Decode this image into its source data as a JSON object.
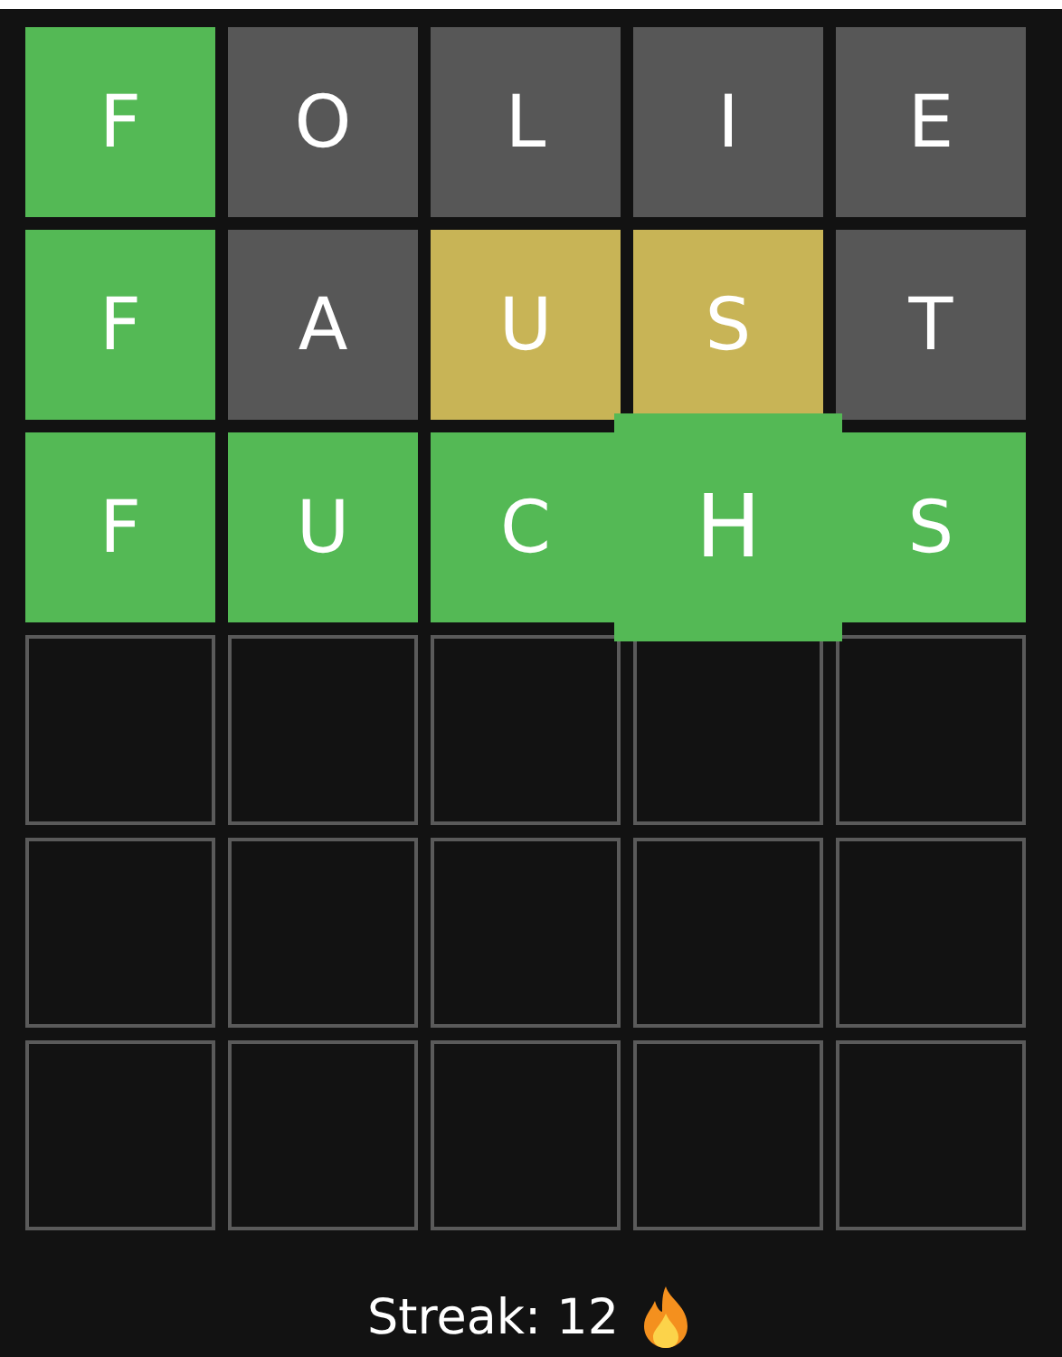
{
  "board": {
    "rows": [
      {
        "tiles": [
          {
            "letter": "F",
            "kind": "correct",
            "enlarged": false
          },
          {
            "letter": "O",
            "kind": "absent",
            "enlarged": false
          },
          {
            "letter": "L",
            "kind": "absent",
            "enlarged": false
          },
          {
            "letter": "I",
            "kind": "absent",
            "enlarged": false
          },
          {
            "letter": "E",
            "kind": "absent",
            "enlarged": false
          }
        ]
      },
      {
        "tiles": [
          {
            "letter": "F",
            "kind": "correct",
            "enlarged": false
          },
          {
            "letter": "A",
            "kind": "absent",
            "enlarged": false
          },
          {
            "letter": "U",
            "kind": "present",
            "enlarged": false
          },
          {
            "letter": "S",
            "kind": "present",
            "enlarged": false
          },
          {
            "letter": "T",
            "kind": "absent",
            "enlarged": false
          }
        ]
      },
      {
        "tiles": [
          {
            "letter": "F",
            "kind": "correct",
            "enlarged": false
          },
          {
            "letter": "U",
            "kind": "correct",
            "enlarged": false
          },
          {
            "letter": "C",
            "kind": "correct",
            "enlarged": false
          },
          {
            "letter": "H",
            "kind": "correct",
            "enlarged": true
          },
          {
            "letter": "S",
            "kind": "correct",
            "enlarged": false
          }
        ]
      },
      {
        "tiles": [
          {
            "kind": "empty"
          },
          {
            "kind": "empty"
          },
          {
            "kind": "empty"
          },
          {
            "kind": "empty"
          },
          {
            "kind": "empty"
          }
        ]
      },
      {
        "tiles": [
          {
            "kind": "empty"
          },
          {
            "kind": "empty"
          },
          {
            "kind": "empty"
          },
          {
            "kind": "empty"
          },
          {
            "kind": "empty"
          }
        ]
      },
      {
        "tiles": [
          {
            "kind": "empty"
          },
          {
            "kind": "empty"
          },
          {
            "kind": "empty"
          },
          {
            "kind": "empty"
          },
          {
            "kind": "empty"
          }
        ]
      }
    ]
  },
  "streak": {
    "label": "Streak: 12"
  }
}
